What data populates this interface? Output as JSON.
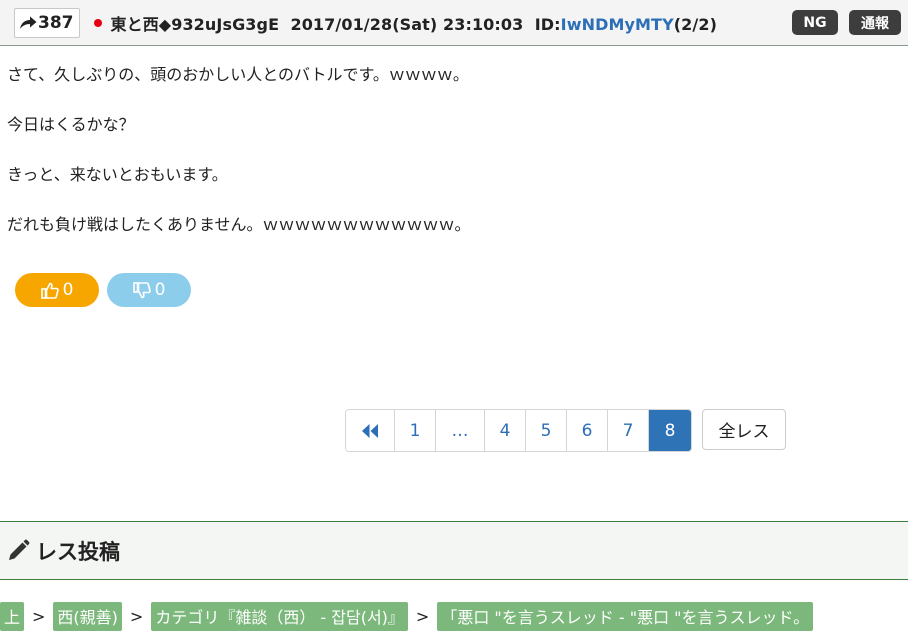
{
  "post": {
    "number": "387",
    "author": "東と西◆932uJsG3gE",
    "date": "2017/01/28(Sat) 23:10:03",
    "id_label": "ID:",
    "id_value": "IwNDMyMTY",
    "id_count": "(2/2)",
    "ng_label": "NG",
    "report_label": "通報",
    "lines": [
      "さて、久しぶりの、頭のおかしい人とのバトルです。ｗｗｗｗ。",
      "今日はくるかな？",
      "きっと、来ないとおもいます。",
      "だれも負け戦はしたくありません。ｗｗｗｗｗｗｗｗｗｗｗｗ。"
    ],
    "likes": "0",
    "dislikes": "0"
  },
  "pagination": {
    "pages": [
      "1",
      "…",
      "4",
      "5",
      "6",
      "7",
      "8"
    ],
    "current": "8",
    "all_label": "全レス"
  },
  "reply_section": {
    "title": "レス投稿"
  },
  "breadcrumb": {
    "separator": ">",
    "items": [
      "上",
      "西(親善)",
      "カテゴリ『雑談（西） - 잡담(서)』",
      "「悪口 \"を言うスレッド - \"悪口 \"を言うスレッド。"
    ]
  },
  "colors": {
    "accent_blue": "#2e73b6",
    "like_orange": "#f7a600",
    "dislike_blue": "#8dcdec",
    "breadcrumb_green": "#7cb87c",
    "tag_dark": "#3d3d3d"
  }
}
